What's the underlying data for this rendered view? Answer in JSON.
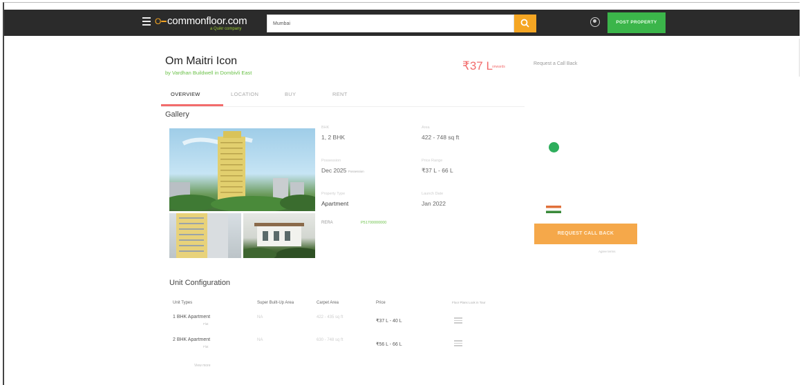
{
  "header": {
    "logo_text": "commonfloor.com",
    "logo_tagline": "a Quikr company",
    "search_value": "Mumbai",
    "post_property_label": "POST PROPERTY"
  },
  "project": {
    "title": "Om Maitri Icon",
    "subtitle": "by Vardhan Buildwell in Dombivli East",
    "price": "₹37 L",
    "price_suffix": "onwards",
    "callback_link": "Request a Call Back"
  },
  "tabs": [
    {
      "label": "OVERVIEW",
      "active": true
    },
    {
      "label": "LOCATION",
      "active": false
    },
    {
      "label": "BUY",
      "active": false
    },
    {
      "label": "RENT",
      "active": false
    }
  ],
  "gallery": {
    "title": "Gallery"
  },
  "details": [
    {
      "label": "BHK",
      "value": "1, 2 BHK",
      "note": ""
    },
    {
      "label": "Area",
      "value": "422 - 748 sq ft",
      "note": ""
    },
    {
      "label": "Possession",
      "value": "Dec 2025",
      "note": "Possession"
    },
    {
      "label": "Price Range",
      "value": "₹37 L - 66 L",
      "note": ""
    },
    {
      "label": "Property Type",
      "value": "Apartment",
      "note": ""
    },
    {
      "label": "Launch Date",
      "value": "Jan 2022",
      "note": ""
    }
  ],
  "rera": {
    "label": "RERA",
    "link": "P51700000000"
  },
  "callback": {
    "button_label": "REQUEST CALL BACK",
    "note": "Agree terms"
  },
  "unit_config": {
    "title": "Unit Configuration",
    "columns": [
      "Unit Types",
      "Super Built-Up Area",
      "Carpet Area",
      "Price",
      "Floor Plans Look in Tour"
    ],
    "rows": [
      {
        "type": "1 BHK Apartment",
        "sub": "Flat",
        "super": "NA",
        "carpet": "422 - 435 sq ft",
        "price": "₹37 L - 40 L"
      },
      {
        "type": "2 BHK Apartment",
        "sub": "Flat",
        "super": "NA",
        "carpet": "630 - 748 sq ft",
        "price": "₹56 L - 66 L"
      }
    ],
    "view_all": "View more"
  }
}
